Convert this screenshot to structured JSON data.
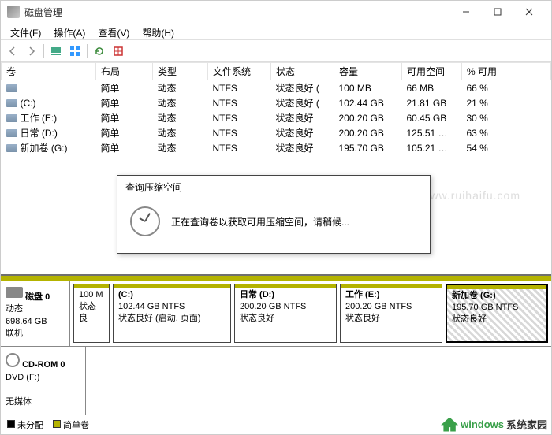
{
  "title": "磁盘管理",
  "menus": [
    "文件(F)",
    "操作(A)",
    "查看(V)",
    "帮助(H)"
  ],
  "columns": [
    "卷",
    "布局",
    "类型",
    "文件系统",
    "状态",
    "容量",
    "可用空间",
    "% 可用"
  ],
  "rows": [
    {
      "vol": "",
      "layout": "简单",
      "type": "动态",
      "fs": "NTFS",
      "status": "状态良好 (",
      "cap": "100 MB",
      "free": "66 MB",
      "pct": "66 %"
    },
    {
      "vol": "(C:)",
      "layout": "简单",
      "type": "动态",
      "fs": "NTFS",
      "status": "状态良好 (",
      "cap": "102.44 GB",
      "free": "21.81 GB",
      "pct": "21 %"
    },
    {
      "vol": "工作 (E:)",
      "layout": "简单",
      "type": "动态",
      "fs": "NTFS",
      "status": "状态良好",
      "cap": "200.20 GB",
      "free": "60.45 GB",
      "pct": "30 %"
    },
    {
      "vol": "日常 (D:)",
      "layout": "简单",
      "type": "动态",
      "fs": "NTFS",
      "status": "状态良好",
      "cap": "200.20 GB",
      "free": "125.51 …",
      "pct": "63 %"
    },
    {
      "vol": "新加卷 (G:)",
      "layout": "简单",
      "type": "动态",
      "fs": "NTFS",
      "status": "状态良好",
      "cap": "195.70 GB",
      "free": "105.21 …",
      "pct": "54 %"
    }
  ],
  "disk0": {
    "name": "磁盘 0",
    "type": "动态",
    "size": "698.64 GB",
    "state": "联机"
  },
  "parts": [
    {
      "title": "",
      "line1": "100 M",
      "line2": "状态良"
    },
    {
      "title": "(C:)",
      "line1": "102.44 GB NTFS",
      "line2": "状态良好 (启动, 页面)"
    },
    {
      "title": "日常   (D:)",
      "line1": "200.20 GB NTFS",
      "line2": "状态良好"
    },
    {
      "title": "工作   (E:)",
      "line1": "200.20 GB NTFS",
      "line2": "状态良好"
    },
    {
      "title": "新加卷   (G:)",
      "line1": "195.70 GB NTFS",
      "line2": "状态良好"
    }
  ],
  "cdrom": {
    "name": "CD-ROM 0",
    "sub": "DVD (F:)",
    "state": "无媒体"
  },
  "legend": {
    "a": "未分配",
    "b": "简单卷"
  },
  "dialog": {
    "title": "查询压缩空间",
    "msg": "正在查询卷以获取可用压缩空间，请稍候..."
  },
  "wm": {
    "a": "windows",
    "b": "系统家园"
  },
  "wm2": "www.ruihaifu.com"
}
